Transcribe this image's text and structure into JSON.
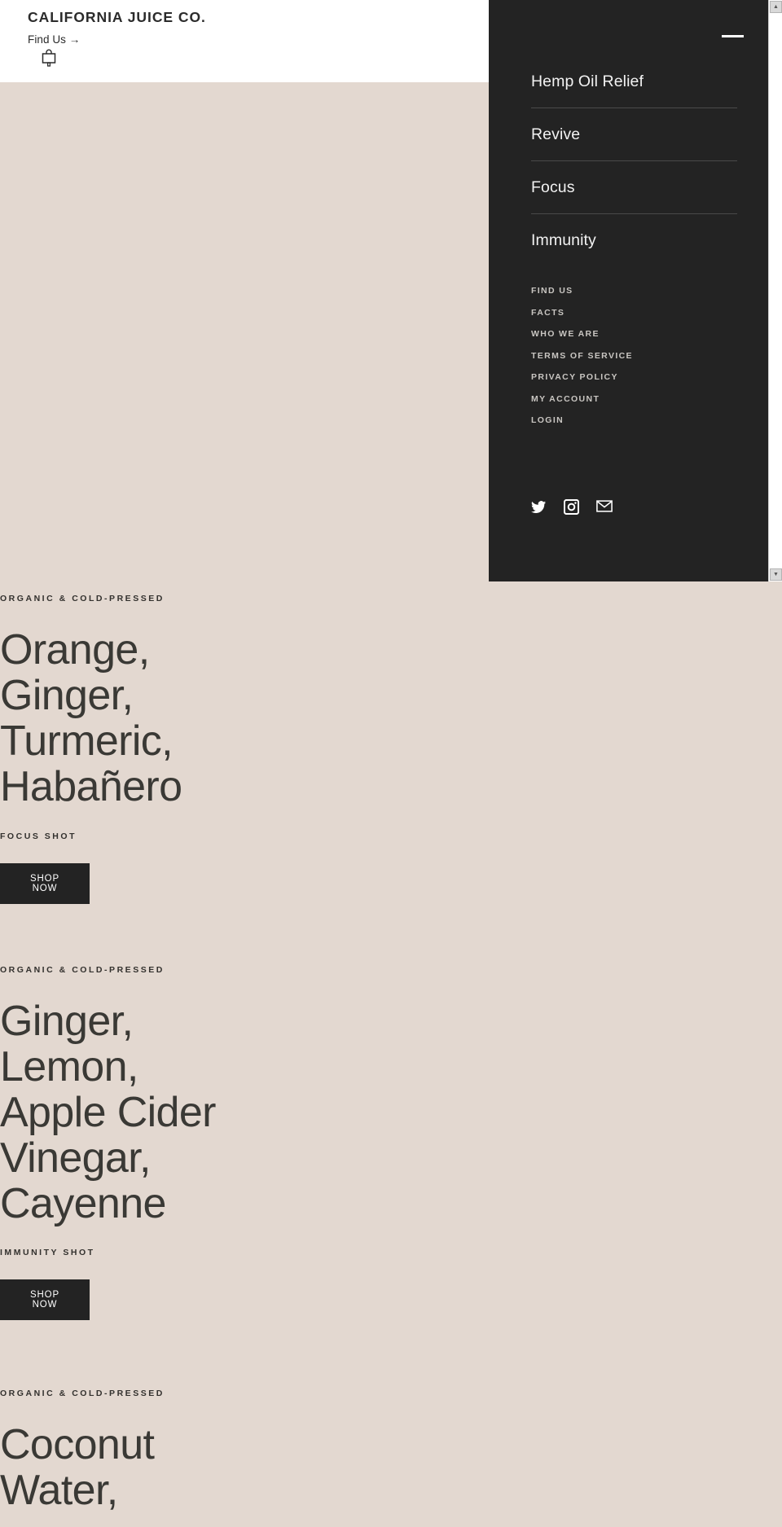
{
  "colors": {
    "page_bg": "#E3D8D0",
    "header_bg": "#FFFFFF",
    "menu_bg": "#232323",
    "text_dark": "#3A3935",
    "text_light": "#F2F2F2",
    "muted_light": "#C9C6C2",
    "button_bg": "#232323",
    "button_text": "#FFFFFF",
    "divider": "#4A4A4A"
  },
  "header": {
    "brand": "CALIFORNIA JUICE CO.",
    "find_us": "Find Us →",
    "bag_icon": "shopping-bag-icon"
  },
  "menu": {
    "close_icon": "minimize-line-icon",
    "primary": [
      {
        "label": "Hemp Oil Relief"
      },
      {
        "label": "Revive"
      },
      {
        "label": "Focus"
      },
      {
        "label": "Immunity"
      }
    ],
    "secondary": [
      {
        "label": "FIND US"
      },
      {
        "label": "FACTS"
      },
      {
        "label": "WHO WE ARE"
      },
      {
        "label": "TERMS OF SERVICE"
      },
      {
        "label": "PRIVACY POLICY"
      },
      {
        "label": "MY ACCOUNT"
      },
      {
        "label": "LOGIN"
      }
    ],
    "social": [
      {
        "name": "twitter-icon"
      },
      {
        "name": "instagram-icon"
      },
      {
        "name": "email-icon"
      }
    ],
    "scrollbar": {
      "up_arrow": "▲",
      "down_arrow": "▼"
    }
  },
  "products": [
    {
      "eyebrow": "ORGANIC & COLD-PRESSED",
      "title": "Orange,\nGinger,\nTurmeric,\nHabañero",
      "subtitle": "FOCUS SHOT",
      "cta": "SHOP NOW"
    },
    {
      "eyebrow": "ORGANIC & COLD-PRESSED",
      "title": "Ginger,\nLemon,\nApple Cider\nVinegar,\nCayenne",
      "subtitle": "IMMUNITY SHOT",
      "cta": "SHOP NOW"
    },
    {
      "eyebrow": "ORGANIC & COLD-PRESSED",
      "title": "Coconut\nWater,",
      "subtitle": "",
      "cta": ""
    }
  ]
}
